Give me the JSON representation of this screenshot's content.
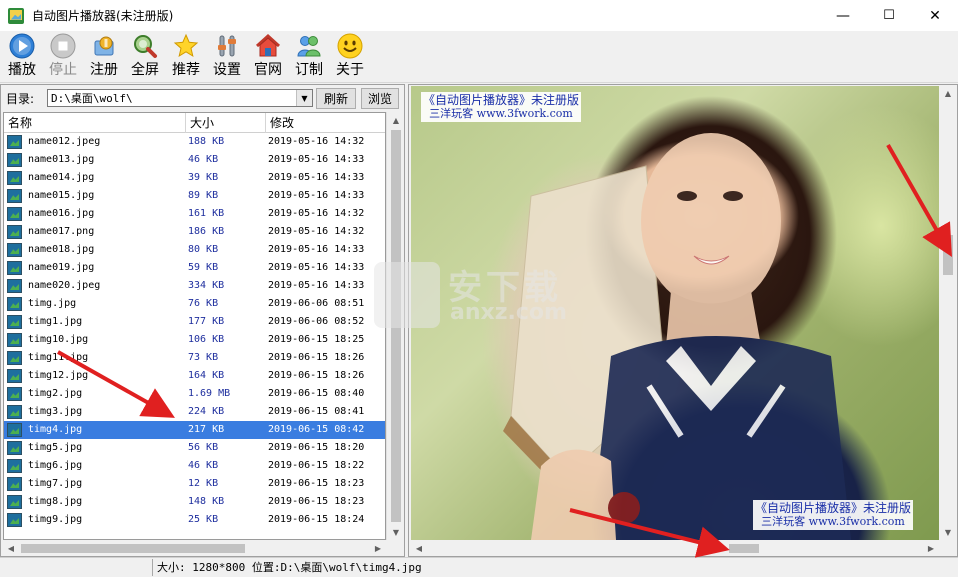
{
  "window": {
    "title": "自动图片播放器(未注册版)",
    "min_glyph": "—",
    "max_glyph": "☐",
    "close_glyph": "✕"
  },
  "toolbar": [
    {
      "label": "播放",
      "icon": "play-icon",
      "enabled": true
    },
    {
      "label": "停止",
      "icon": "stop-icon",
      "enabled": false
    },
    {
      "label": "注册",
      "icon": "register-icon",
      "enabled": true
    },
    {
      "label": "全屏",
      "icon": "fullscreen-icon",
      "enabled": true
    },
    {
      "label": "推荐",
      "icon": "star-icon",
      "enabled": true
    },
    {
      "label": "设置",
      "icon": "settings-icon",
      "enabled": true
    },
    {
      "label": "官网",
      "icon": "home-icon",
      "enabled": true
    },
    {
      "label": "订制",
      "icon": "users-icon",
      "enabled": true
    },
    {
      "label": "关于",
      "icon": "smiley-icon",
      "enabled": true
    }
  ],
  "dir": {
    "label": "目录:",
    "value": "D:\\桌面\\wolf\\",
    "refresh_label": "刷新",
    "browse_label": "浏览"
  },
  "list": {
    "columns": [
      "名称",
      "大小",
      "修改"
    ],
    "selected_index": 15,
    "rows": [
      {
        "name": "name012.jpeg",
        "size": "188 KB",
        "date": "2019-05-16 14:32"
      },
      {
        "name": "name013.jpg",
        "size": "46 KB",
        "date": "2019-05-16 14:33"
      },
      {
        "name": "name014.jpg",
        "size": "39 KB",
        "date": "2019-05-16 14:33"
      },
      {
        "name": "name015.jpg",
        "size": "89 KB",
        "date": "2019-05-16 14:33"
      },
      {
        "name": "name016.jpg",
        "size": "161 KB",
        "date": "2019-05-16 14:32"
      },
      {
        "name": "name017.png",
        "size": "186 KB",
        "date": "2019-05-16 14:32"
      },
      {
        "name": "name018.jpg",
        "size": "80 KB",
        "date": "2019-05-16 14:33"
      },
      {
        "name": "name019.jpg",
        "size": "59 KB",
        "date": "2019-05-16 14:33"
      },
      {
        "name": "name020.jpeg",
        "size": "334 KB",
        "date": "2019-05-16 14:33"
      },
      {
        "name": "timg.jpg",
        "size": "76 KB",
        "date": "2019-06-06 08:51"
      },
      {
        "name": "timg1.jpg",
        "size": "177 KB",
        "date": "2019-06-06 08:52"
      },
      {
        "name": "timg10.jpg",
        "size": "106 KB",
        "date": "2019-06-15 18:25"
      },
      {
        "name": "timg11.jpg",
        "size": "73 KB",
        "date": "2019-06-15 18:26"
      },
      {
        "name": "timg12.jpg",
        "size": "164 KB",
        "date": "2019-06-15 18:26"
      },
      {
        "name": "timg2.jpg",
        "size": "1.69 MB",
        "date": "2019-06-15 08:40"
      },
      {
        "name": "timg3.jpg",
        "size": "224 KB",
        "date": "2019-06-15 08:41"
      },
      {
        "name": "timg4.jpg",
        "size": "217 KB",
        "date": "2019-06-15 08:42"
      },
      {
        "name": "timg5.jpg",
        "size": "56 KB",
        "date": "2019-06-15 18:20"
      },
      {
        "name": "timg6.jpg",
        "size": "46 KB",
        "date": "2019-06-15 18:22"
      },
      {
        "name": "timg7.jpg",
        "size": "12 KB",
        "date": "2019-06-15 18:23"
      },
      {
        "name": "timg8.jpg",
        "size": "148 KB",
        "date": "2019-06-15 18:23"
      },
      {
        "name": "timg9.jpg",
        "size": "25 KB",
        "date": "2019-06-15 18:24"
      }
    ]
  },
  "viewer": {
    "watermark_line1": "《自动图片播放器》未注册版",
    "watermark_line2": "三洋玩客 www.3fwork.com"
  },
  "status": {
    "text": "大小: 1280*800 位置:D:\\桌面\\wolf\\timg4.jpg"
  },
  "site_watermark": {
    "line1": "安下载",
    "line2": "anxz.com"
  },
  "colors": {
    "selection": "#3a7de0",
    "size_text": "#1e2e9e",
    "watermark_text": "#1a2fa8",
    "annotation_arrow": "#e02020"
  }
}
